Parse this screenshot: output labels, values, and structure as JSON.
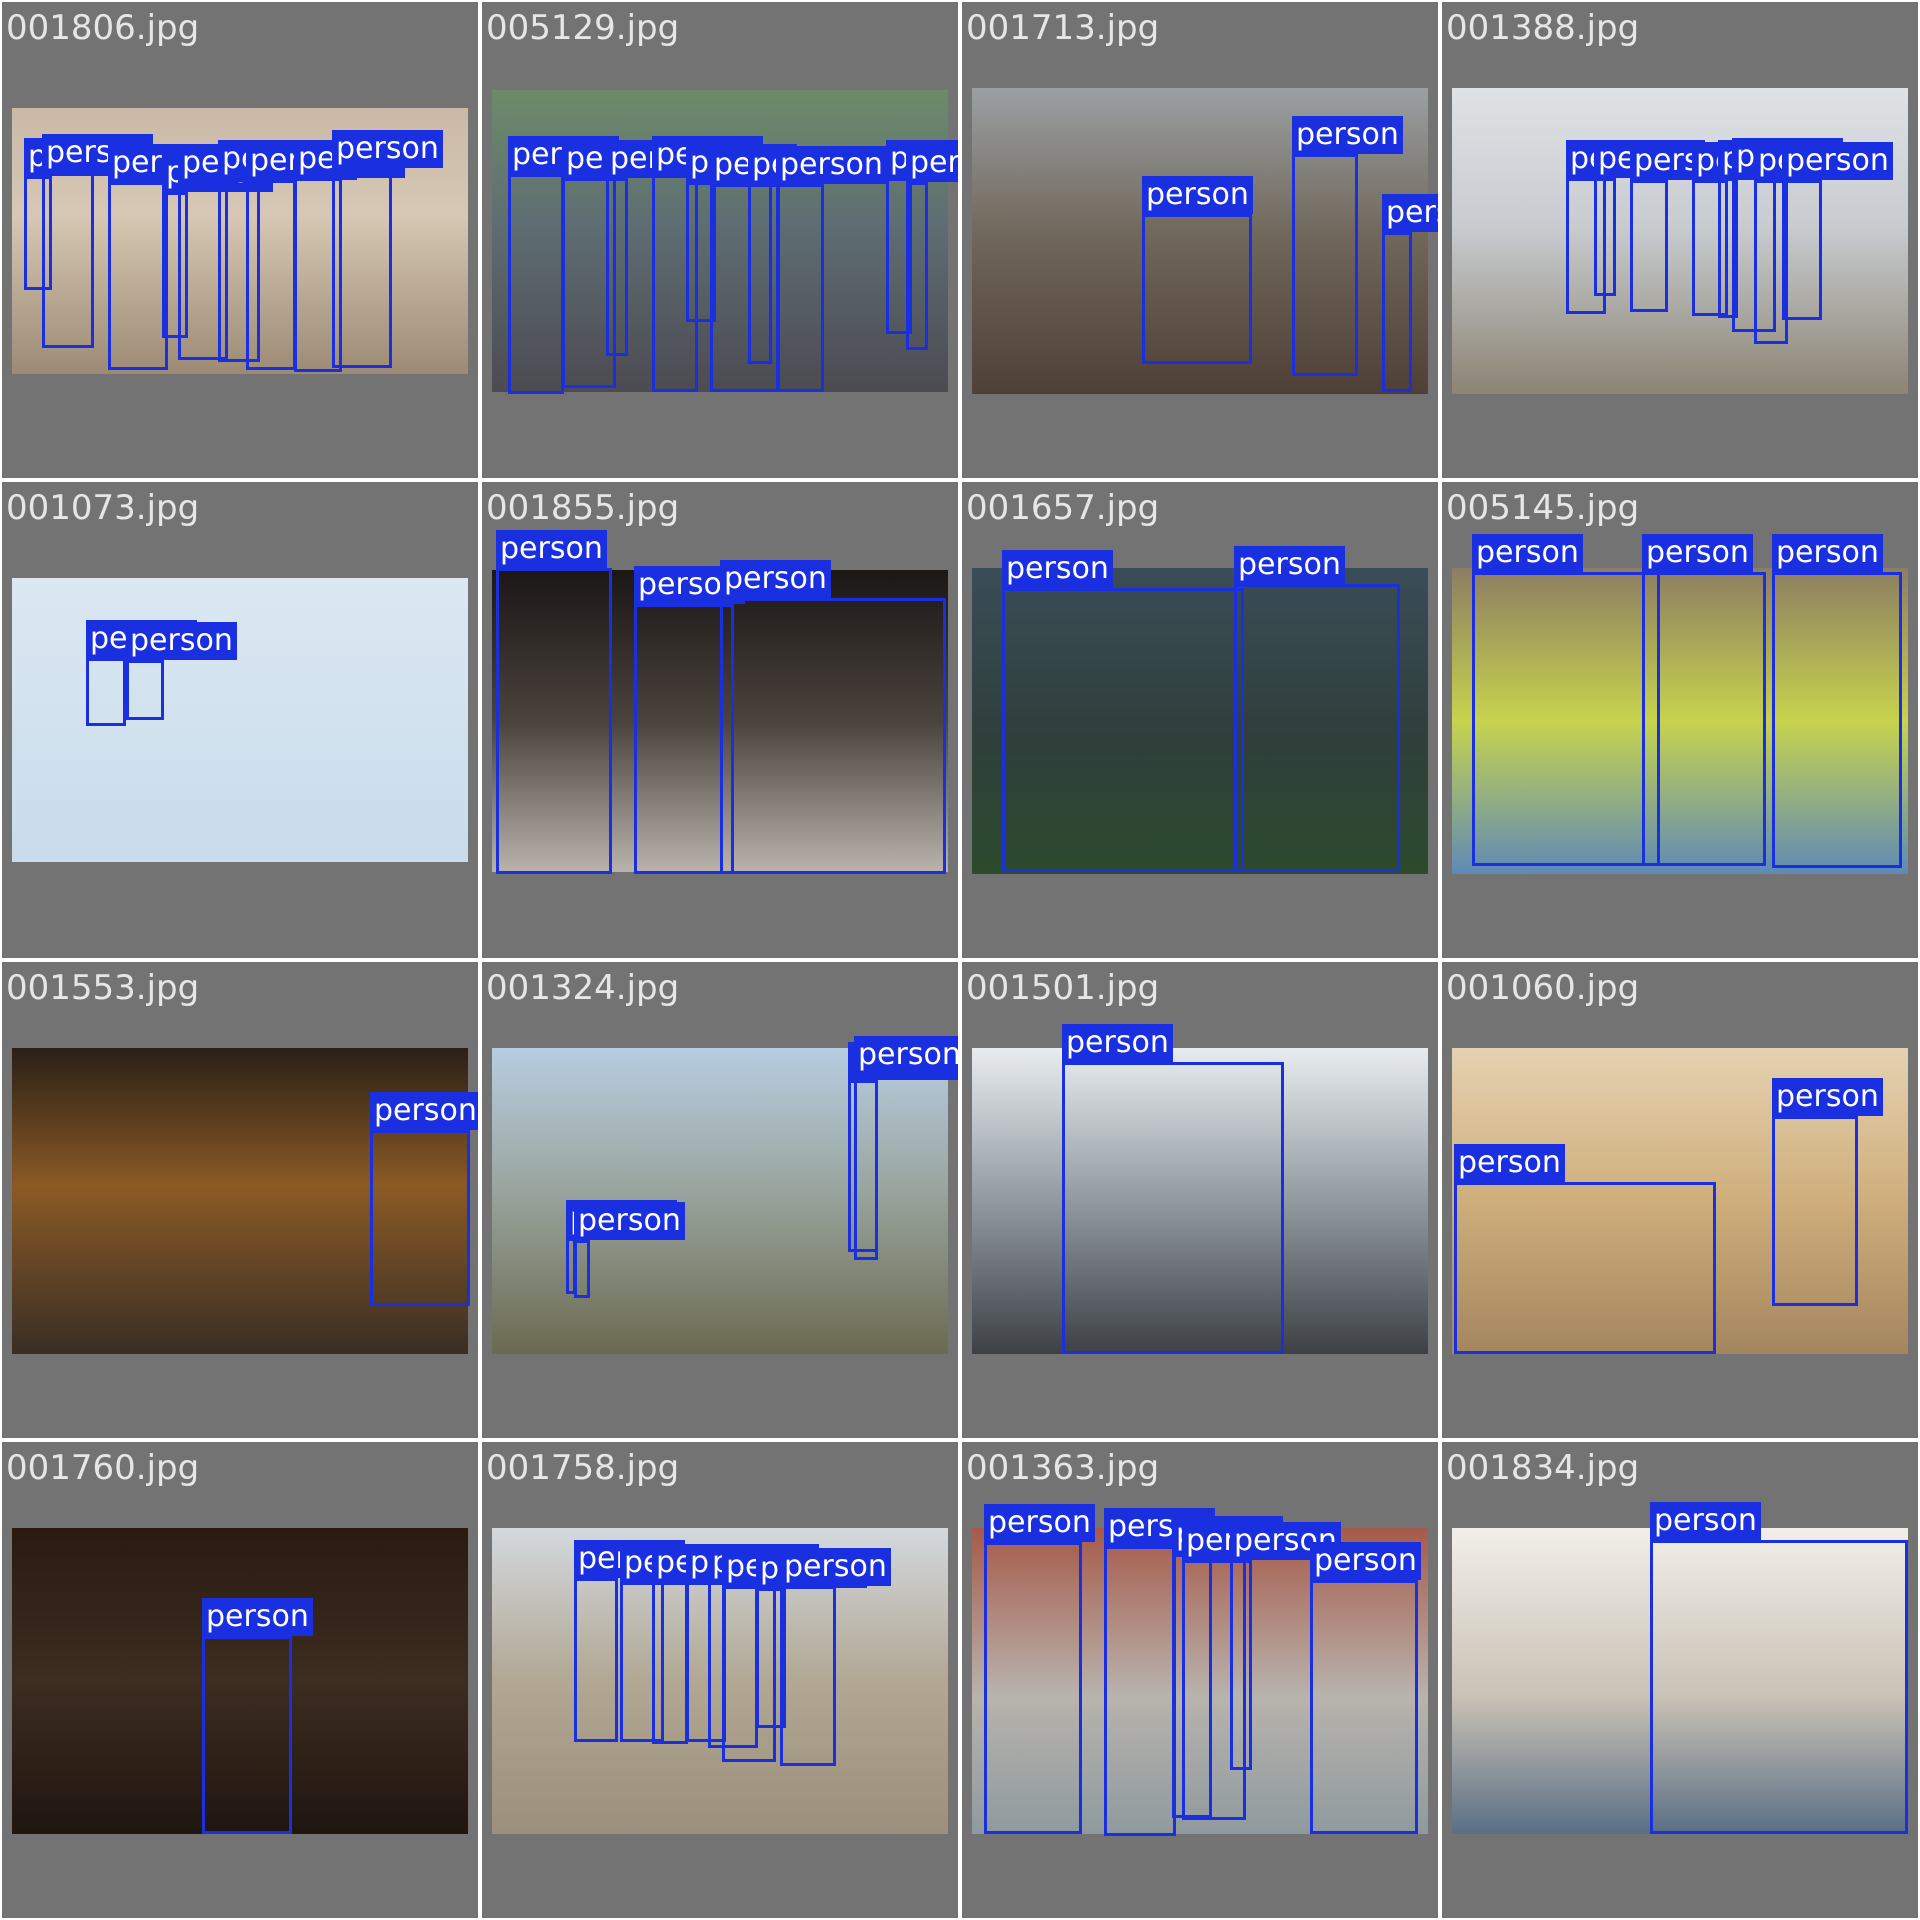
{
  "class_label": "person",
  "colors": {
    "box": "#1a2fe0",
    "cell_bg": "#737373",
    "filename_text": "#e6e6e6"
  },
  "images": [
    {
      "filename": "001806.jpg",
      "person_count": 9
    },
    {
      "filename": "005129.jpg",
      "person_count": 10
    },
    {
      "filename": "001713.jpg",
      "person_count": 3
    },
    {
      "filename": "001388.jpg",
      "person_count": 8
    },
    {
      "filename": "001073.jpg",
      "person_count": 2
    },
    {
      "filename": "001855.jpg",
      "person_count": 3
    },
    {
      "filename": "001657.jpg",
      "person_count": 2
    },
    {
      "filename": "005145.jpg",
      "person_count": 3
    },
    {
      "filename": "001553.jpg",
      "person_count": 1
    },
    {
      "filename": "001324.jpg",
      "person_count": 4
    },
    {
      "filename": "001501.jpg",
      "person_count": 1
    },
    {
      "filename": "001060.jpg",
      "person_count": 2
    },
    {
      "filename": "001760.jpg",
      "person_count": 1
    },
    {
      "filename": "001758.jpg",
      "person_count": 8
    },
    {
      "filename": "001363.jpg",
      "person_count": 6
    },
    {
      "filename": "001834.jpg",
      "person_count": 1
    }
  ]
}
